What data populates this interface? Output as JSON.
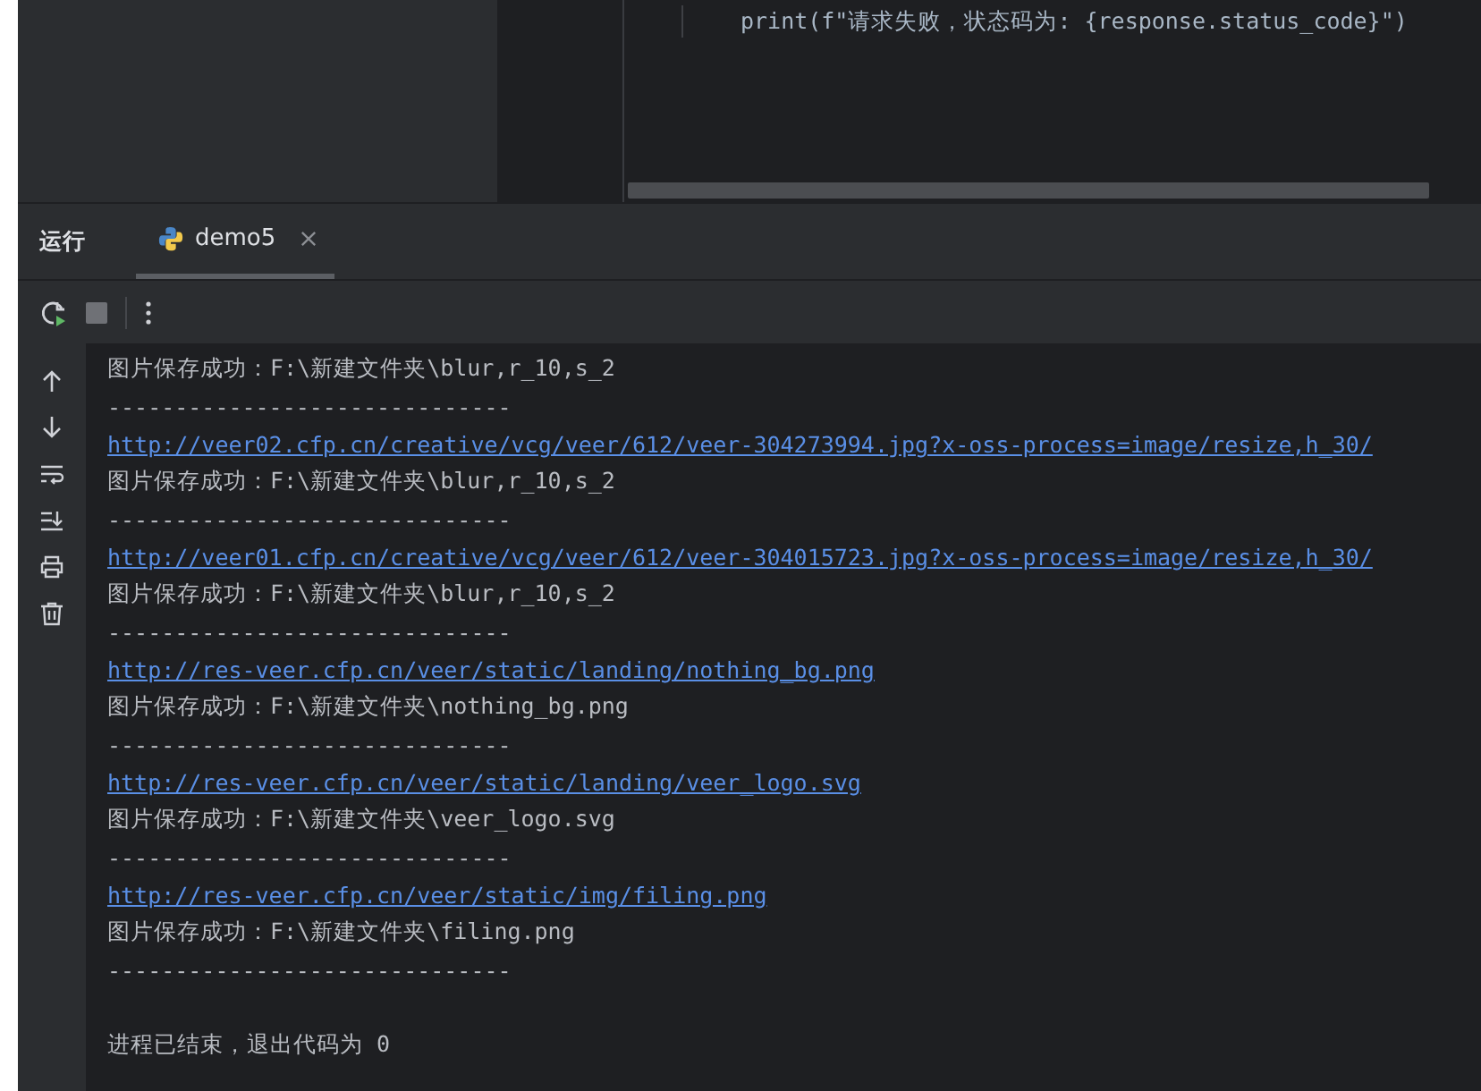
{
  "editor": {
    "code_line": "print(f\"请求失败，状态码为: {response.status_code}\")"
  },
  "tool_window": {
    "title": "运行",
    "tabs": [
      {
        "label": "demo5",
        "selected": true
      }
    ]
  },
  "console": {
    "lines": [
      {
        "kind": "info",
        "text": "图片保存成功：F:\\新建文件夹\\blur,r_10,s_2"
      },
      {
        "kind": "separator",
        "text": "------------------------------"
      },
      {
        "kind": "link",
        "text": "http://veer02.cfp.cn/creative/vcg/veer/612/veer-304273994.jpg?x-oss-process=image/resize,h_30/"
      },
      {
        "kind": "info",
        "text": "图片保存成功：F:\\新建文件夹\\blur,r_10,s_2"
      },
      {
        "kind": "separator",
        "text": "------------------------------"
      },
      {
        "kind": "link",
        "text": "http://veer01.cfp.cn/creative/vcg/veer/612/veer-304015723.jpg?x-oss-process=image/resize,h_30/"
      },
      {
        "kind": "info",
        "text": "图片保存成功：F:\\新建文件夹\\blur,r_10,s_2"
      },
      {
        "kind": "separator",
        "text": "------------------------------"
      },
      {
        "kind": "link",
        "text": "http://res-veer.cfp.cn/veer/static/landing/nothing_bg.png"
      },
      {
        "kind": "info",
        "text": "图片保存成功：F:\\新建文件夹\\nothing_bg.png"
      },
      {
        "kind": "separator",
        "text": "------------------------------"
      },
      {
        "kind": "link",
        "text": "http://res-veer.cfp.cn/veer/static/landing/veer_logo.svg"
      },
      {
        "kind": "info",
        "text": "图片保存成功：F:\\新建文件夹\\veer_logo.svg"
      },
      {
        "kind": "separator",
        "text": "------------------------------"
      },
      {
        "kind": "link",
        "text": "http://res-veer.cfp.cn/veer/static/img/filing.png"
      },
      {
        "kind": "info",
        "text": "图片保存成功：F:\\新建文件夹\\filing.png"
      },
      {
        "kind": "separator",
        "text": "------------------------------"
      },
      {
        "kind": "blank"
      },
      {
        "kind": "exit",
        "text": "进程已结束，退出代码为 0"
      }
    ]
  }
}
